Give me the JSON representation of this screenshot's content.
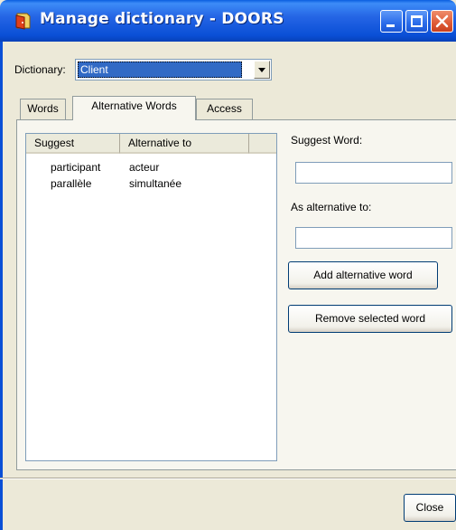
{
  "window": {
    "title": "Manage dictionary - DOORS",
    "colors": {
      "titlebar": "#0a4fd6",
      "close_button": "#de5a36",
      "selection": "#316ac5"
    }
  },
  "dictionary": {
    "label": "Dictionary:",
    "selected": "Client"
  },
  "tabs": [
    {
      "label": "Words",
      "active": false
    },
    {
      "label": "Alternative Words",
      "active": true
    },
    {
      "label": "Access",
      "active": false
    }
  ],
  "list": {
    "columns": [
      "Suggest",
      "Alternative to",
      ""
    ],
    "rows": [
      {
        "suggest": "participant",
        "alternative": "acteur"
      },
      {
        "suggest": "parallèle",
        "alternative": "simultanée"
      }
    ]
  },
  "form": {
    "suggest_label": "Suggest Word:",
    "suggest_value": "",
    "alternative_label": "As alternative to:",
    "alternative_value": "",
    "add_button": "Add alternative word",
    "remove_button": "Remove selected word"
  },
  "footer": {
    "close_button": "Close"
  },
  "icons": {
    "app": "doors-app-icon",
    "minimize": "minimize-icon",
    "maximize": "maximize-icon",
    "close": "close-icon",
    "dropdown": "chevron-down-icon"
  }
}
